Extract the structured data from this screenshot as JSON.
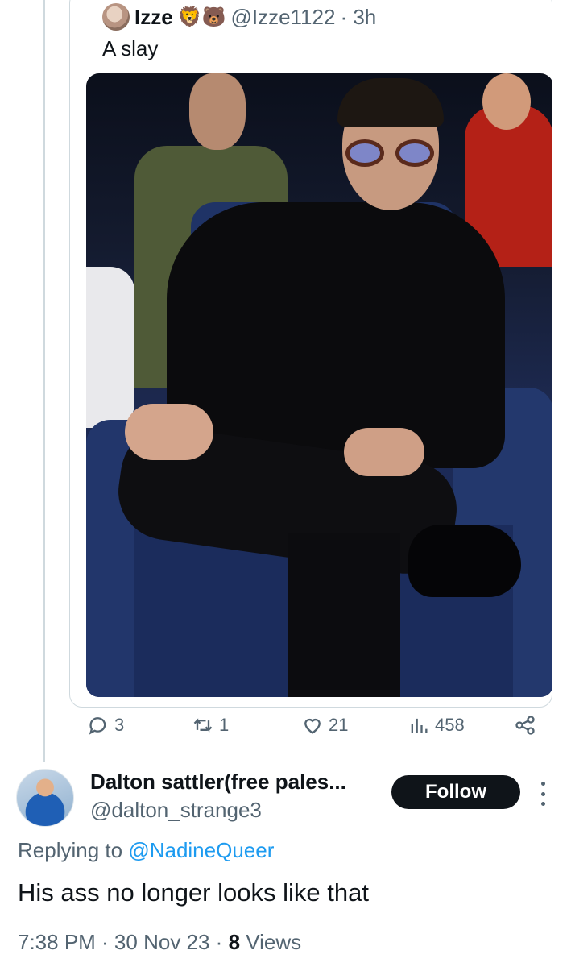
{
  "quoted_tweet": {
    "name": "Izze",
    "emojis": "🦁🐻",
    "handle": "@Izze1122",
    "time": "· 3h",
    "text": "A slay"
  },
  "actions": {
    "replies": "3",
    "reposts": "1",
    "likes": "21",
    "views": "458"
  },
  "reply": {
    "name": "Dalton sattler(free pales...",
    "handle": "@dalton_strange3",
    "follow_label": "Follow",
    "replying_prefix": "Replying to",
    "replying_to": "@NadineQueer",
    "text": "His ass no longer looks like that",
    "time": "7:38 PM · 30 Nov 23 ·",
    "views_count": "8",
    "views_label": "Views"
  },
  "colors": {
    "accent": "#1d9bf0",
    "muted": "#536471",
    "text": "#0f1419"
  }
}
